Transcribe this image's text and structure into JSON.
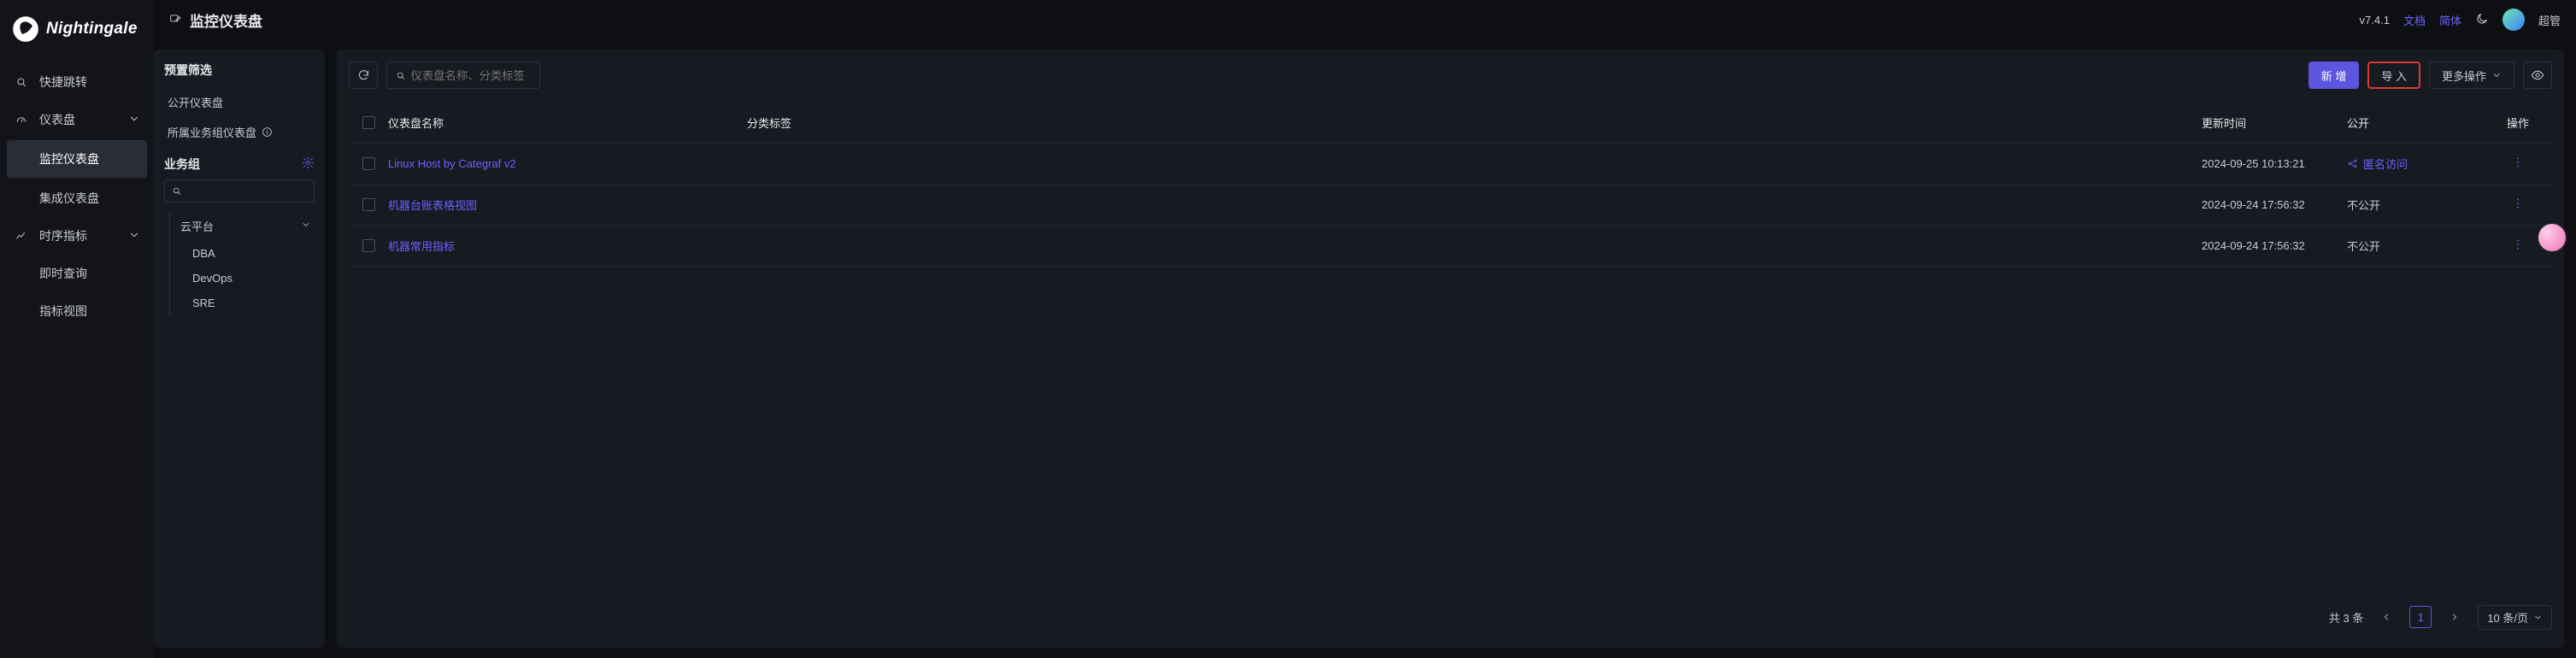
{
  "brand": {
    "name": "Nightingale"
  },
  "topbar": {
    "title": "监控仪表盘",
    "version": "v7.4.1",
    "docs": "文档",
    "lang": "简体",
    "user_role": "超管"
  },
  "leftnav": {
    "quick_jump": "快捷跳转",
    "dashboard": "仪表盘",
    "dashboard_sub": {
      "monitor": "监控仪表盘",
      "integration": "集成仪表盘"
    },
    "ts_metrics": "时序指标",
    "ts_sub": {
      "instant": "即时查询",
      "metric_view": "指标视图"
    }
  },
  "side2": {
    "preset_title": "预置筛选",
    "public": "公开仪表盘",
    "belong": "所属业务组仪表盘",
    "biz_title": "业务组",
    "search_placeholder": "",
    "tree": {
      "root": "云平台",
      "leaves": [
        "DBA",
        "DevOps",
        "SRE"
      ]
    }
  },
  "toolbar": {
    "search_placeholder": "仪表盘名称、分类标签",
    "new": "新 增",
    "import": "导 入",
    "more": "更多操作"
  },
  "table": {
    "headers": {
      "name": "仪表盘名称",
      "tags": "分类标签",
      "updated": "更新时间",
      "public": "公开",
      "actions": "操作"
    },
    "rows": [
      {
        "name": "Linux Host by Categraf v2",
        "tags": "",
        "updated": "2024-09-25 10:13:21",
        "public_label": "匿名访问",
        "public_kind": "anon"
      },
      {
        "name": "机器台账表格视图",
        "tags": "",
        "updated": "2024-09-24 17:56:32",
        "public_label": "不公开",
        "public_kind": "private"
      },
      {
        "name": "机器常用指标",
        "tags": "",
        "updated": "2024-09-24 17:56:32",
        "public_label": "不公开",
        "public_kind": "private"
      }
    ]
  },
  "pager": {
    "total_text": "共 3 条",
    "current": "1",
    "size_label": "10 条/页"
  }
}
